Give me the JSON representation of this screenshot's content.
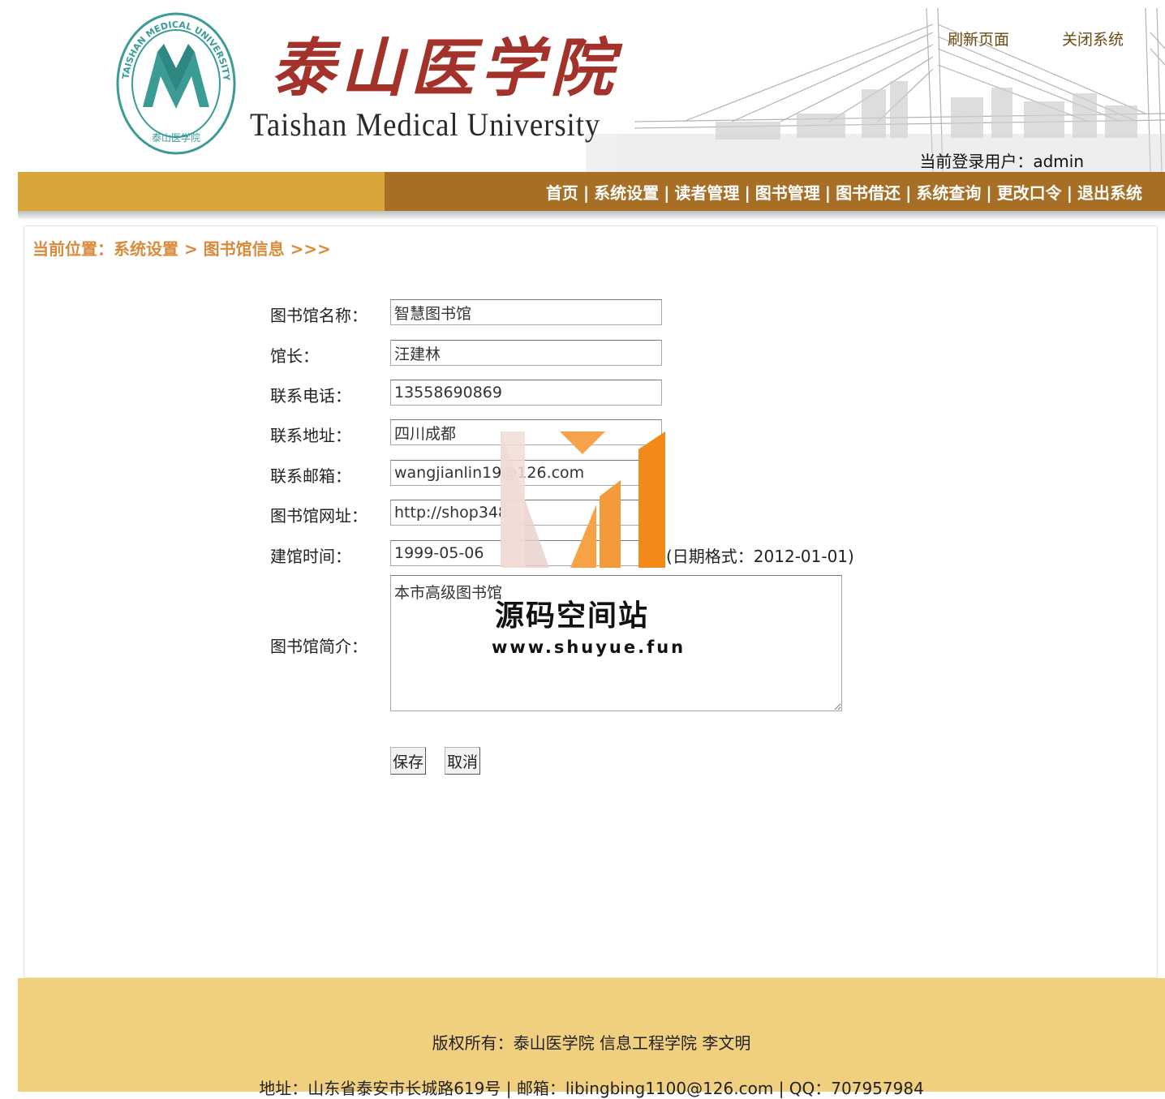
{
  "header": {
    "seal_text": "TAISHAN MEDICAL UNIVERSITY",
    "title_cn": "泰山医学院",
    "title_en": "Taishan Medical University",
    "refresh_link": "刷新页面",
    "close_link": "关闭系统",
    "login_user": "当前登录用户：admin"
  },
  "nav": {
    "items": [
      "首页",
      "系统设置",
      "读者管理",
      "图书管理",
      "图书借还",
      "系统查询",
      "更改口令",
      "退出系统"
    ],
    "separator": "|"
  },
  "breadcrumb": "当前位置：系统设置 > 图书馆信息 >>>",
  "form": {
    "name": {
      "label": "图书馆名称：",
      "value": "智慧图书馆"
    },
    "curator": {
      "label": "馆长：",
      "value": "汪建林"
    },
    "phone": {
      "label": "联系电话：",
      "value": "13558690869"
    },
    "address": {
      "label": "联系地址：",
      "value": "四川成都"
    },
    "email": {
      "label": "联系邮箱：",
      "value": "wangjianlin19@126.com"
    },
    "website": {
      "label": "图书馆网址：",
      "value": "http://shop348"
    },
    "founded": {
      "label": "建馆时间：",
      "value": "1999-05-06",
      "hint": "(日期格式：2012-01-01)"
    },
    "intro": {
      "label": "图书馆简介：",
      "value": "本市高级图书馆"
    },
    "save_label": "保存",
    "cancel_label": "取消"
  },
  "watermark": {
    "title": "源码空间站",
    "url": "www.shuyue.fun"
  },
  "footer": {
    "copyright": "版权所有：泰山医学院 信息工程学院 李文明",
    "contact": "地址：山东省泰安市长城路619号 | 邮箱：libingbing1100@126.com | QQ：707957984"
  },
  "colors": {
    "nav_left": "#d6a63b",
    "nav_right": "#a66f25",
    "footer": "#f0cf7f",
    "breadcrumb": "#d98a3a",
    "title_red": "#a3322a",
    "seal_teal": "#3b9c96"
  }
}
